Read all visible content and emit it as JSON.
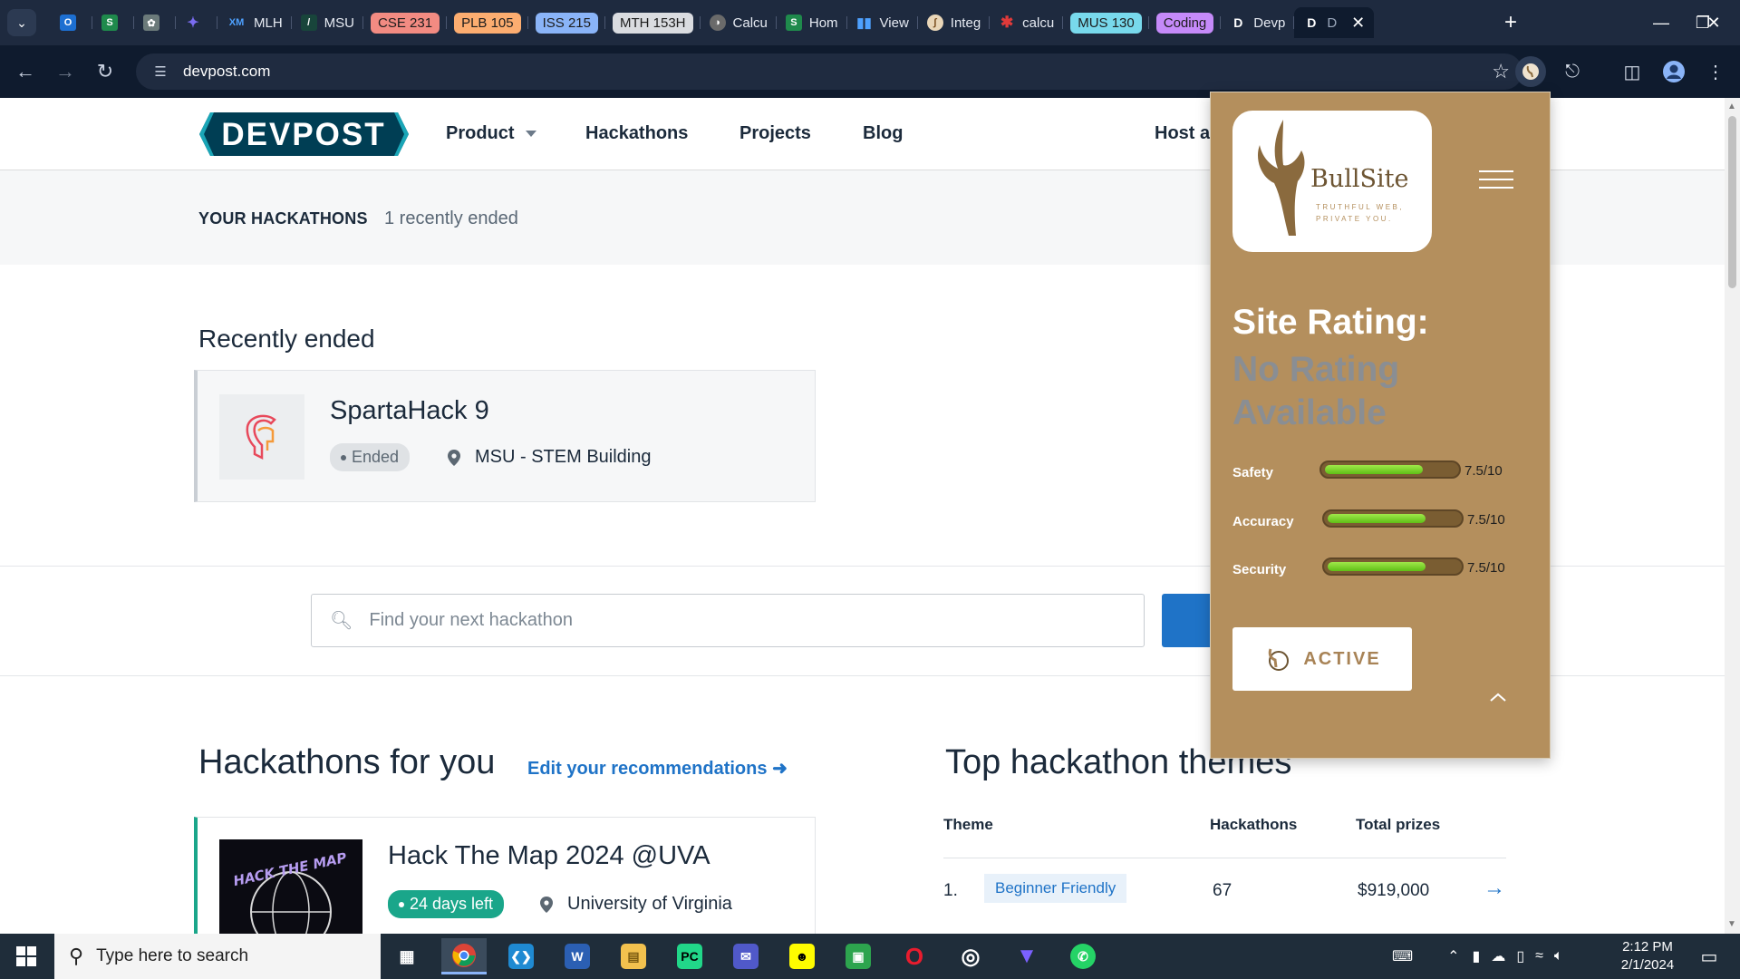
{
  "browser": {
    "tabs": [
      {
        "label": "",
        "favicon": "outlook-icon",
        "color": "#1d6fd1"
      },
      {
        "label": "",
        "favicon": "s-icon",
        "color": "#1f8a4c"
      },
      {
        "label": "",
        "favicon": "chatgpt-icon",
        "color": "#6b7a7a"
      },
      {
        "label": "",
        "favicon": "sparkle-icon",
        "color": "#7a6cf0"
      },
      {
        "label": "MLH",
        "favicon": "xm-icon",
        "color": "#1d6fd1"
      },
      {
        "label": "MSU",
        "favicon": "msu-icon",
        "color": "#18453b"
      }
    ],
    "group_chips": [
      {
        "label": "CSE 231",
        "color": "#f28b82"
      },
      {
        "label": "PLB 105",
        "color": "#fcad70"
      },
      {
        "label": "ISS 215",
        "color": "#8ab4f8"
      },
      {
        "label": "MTH 153H",
        "color": "#dadce0"
      }
    ],
    "tabs2": [
      {
        "label": "Calcu",
        "favicon": "globe-icon",
        "color": "#6a6a6a"
      },
      {
        "label": "Hom",
        "favicon": "s-icon",
        "color": "#1f8a4c"
      },
      {
        "label": "View",
        "favicon": "chart-icon",
        "color": "#1d6fd1"
      },
      {
        "label": "Integ",
        "favicon": "integral-icon",
        "color": "#9a6a3a"
      },
      {
        "label": "calcu",
        "favicon": "gear-red-icon",
        "color": "#d52b2b"
      }
    ],
    "group_chips2": [
      {
        "label": "MUS 130",
        "color": "#78d9ec"
      },
      {
        "label": "Coding",
        "color": "#c58af9"
      }
    ],
    "tab_devpost": {
      "label": "Devp",
      "favicon": "D"
    },
    "active_tab": {
      "label": "D",
      "favicon": "D"
    },
    "url": "devpost.com"
  },
  "site": {
    "nav": {
      "product": "Product",
      "hackathons": "Hackathons",
      "projects": "Projects",
      "blog": "Blog",
      "host": "Host a"
    },
    "your_hackathons": {
      "label": "YOUR HACKATHONS",
      "count": "1 recently ended"
    },
    "recently_ended": {
      "title": "Recently ended",
      "card": {
        "name": "SpartaHack 9",
        "status": "Ended",
        "location": "MSU - STEM Building"
      }
    },
    "search": {
      "placeholder": "Find your next hackathon"
    },
    "for_you": {
      "title": "Hackathons for you",
      "edit_link": "Edit your recommendations",
      "card": {
        "name": "Hack The Map 2024 @UVA",
        "status": "24 days left",
        "location": "University of Virginia",
        "thumb_text": "HACK THE MAP"
      }
    },
    "themes": {
      "title": "Top hackathon themes",
      "headers": [
        "Theme",
        "Hackathons",
        "Total prizes"
      ],
      "rows": [
        {
          "rank": "1.",
          "theme": "Beginner Friendly",
          "hackathons": "67",
          "prizes": "$919,000"
        }
      ]
    }
  },
  "extension": {
    "brand": "BullSite",
    "tagline": "TRUTHFUL WEB, PRIVATE YOU.",
    "rating_title": "Site Rating:",
    "rating_value": "No Rating Available",
    "metrics": [
      {
        "label": "Safety",
        "value": "7.5/10",
        "score": 0.75
      },
      {
        "label": "Accuracy",
        "value": "7.5/10",
        "score": 0.75
      },
      {
        "label": "Security",
        "value": "7.5/10",
        "score": 0.75
      }
    ],
    "status_button": "ACTIVE",
    "colors": {
      "panel": "#b48f5d",
      "bar": "#7ed321"
    }
  },
  "taskbar": {
    "search_placeholder": "Type here to search",
    "time": "2:12 PM",
    "date": "2/1/2024"
  }
}
